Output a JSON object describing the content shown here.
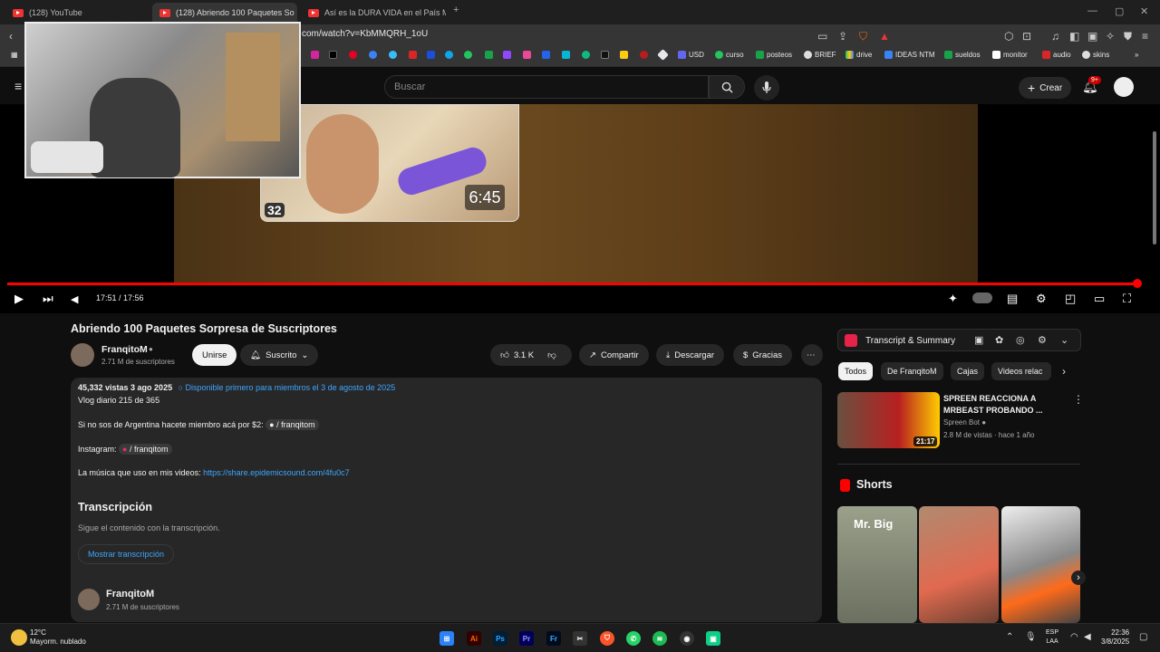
{
  "browser": {
    "tabs": [
      {
        "label": "(128) YouTube"
      },
      {
        "label": "(128) Abriendo 100 Paquetes So"
      },
      {
        "label": "Así es la DURA VIDA en el País Más I"
      }
    ],
    "url": "com/watch?v=KbMMQRH_1oU",
    "bookmarks": [
      "USD",
      "curso",
      "posteos",
      "BRIEF",
      "drive",
      "IDEAS NTM",
      "sueldos",
      "monitor",
      "audio",
      "skins"
    ]
  },
  "youtube_header": {
    "search_placeholder": "Buscar",
    "create_label": "Crear",
    "notif_count": "9+"
  },
  "player": {
    "endscreen_duration": "6:45",
    "thumb_badge": "32",
    "time": "17:51 / 17:56",
    "progress_fraction": 0.995
  },
  "video": {
    "title": "Abriendo 100 Paquetes Sorpresa de Suscriptores",
    "channel": "FranqitoM",
    "subscribers": "2.71 M de suscriptores",
    "join_label": "Unirse",
    "subscribed_label": "Suscrito",
    "likes": "3.1 K",
    "share_label": "Compartir",
    "download_label": "Descargar",
    "thanks_label": "Gracias"
  },
  "description": {
    "stats": "45,332 vistas  3 ago 2025",
    "members_note": "Disponible primero para miembros el 3 de agosto de 2025",
    "line1": "Vlog diario 215 de 365",
    "line2_text": "Si no sos de Argentina hacete miembro acá por $2:",
    "line2_chip": "/ franqitom",
    "line3_text": "Instagram:",
    "line3_chip": "/ franqitom",
    "line4_text": "La música que uso en mis videos:",
    "line4_link": "https://share.epidemicsound.com/4fu0c7",
    "transcript_heading": "Transcripción",
    "transcript_sub": "Sigue el contenido con la transcripción.",
    "transcript_button": "Mostrar transcripción",
    "channel": "FranqitoM",
    "subscribers": "2.71 M de suscriptores"
  },
  "sidebar": {
    "extension_title": "Transcript & Summary",
    "chips": [
      "Todos",
      "De FranqitoM",
      "Cajas",
      "Videos relac"
    ],
    "recommended": {
      "title": "SPREEN REACCIONA A MRBEAST PROBANDO ...",
      "channel": "Spreen Bot",
      "meta": "2.8 M de vistas · hace 1 año",
      "duration": "21:17"
    },
    "shorts_heading": "Shorts",
    "short1_text": "Mr. Big"
  },
  "taskbar": {
    "temp": "12°C",
    "weather": "Mayorm. nublado",
    "lang1": "ESP",
    "lang2": "LAA",
    "time": "22:36",
    "date": "3/8/2025"
  }
}
